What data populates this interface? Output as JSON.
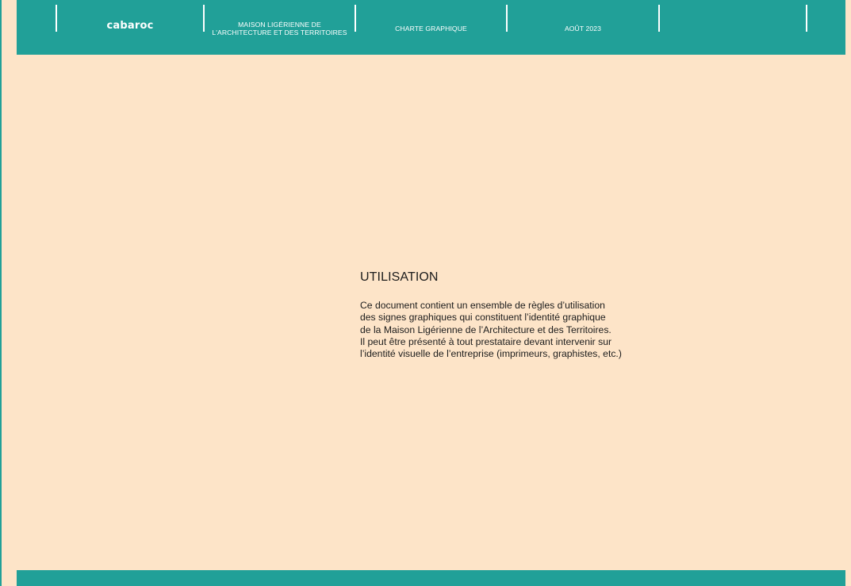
{
  "header": {
    "brand": "cabaroc",
    "organization": "MAISON LIGÉRIENNE DE\nL'ARCHITECTURE ET DES TERRITOIRES",
    "document_type": "CHARTE GRAPHIQUE",
    "date": "AOÛT 2023"
  },
  "content": {
    "title": "UTILISATION",
    "lines": [
      "Ce document contient un ensemble de règles d’utilisation",
      "des signes graphiques qui constituent l’identité graphique",
      "de la Maison Ligérienne de l’Architecture et des Territoires.",
      "Il peut être présenté à tout prestataire devant intervenir sur",
      "l’identité visuelle de l’entreprise (imprimeurs, graphistes, etc.)"
    ]
  },
  "colors": {
    "accent": "#21a098",
    "background": "#fde4c8",
    "text": "#1c1c1c"
  }
}
